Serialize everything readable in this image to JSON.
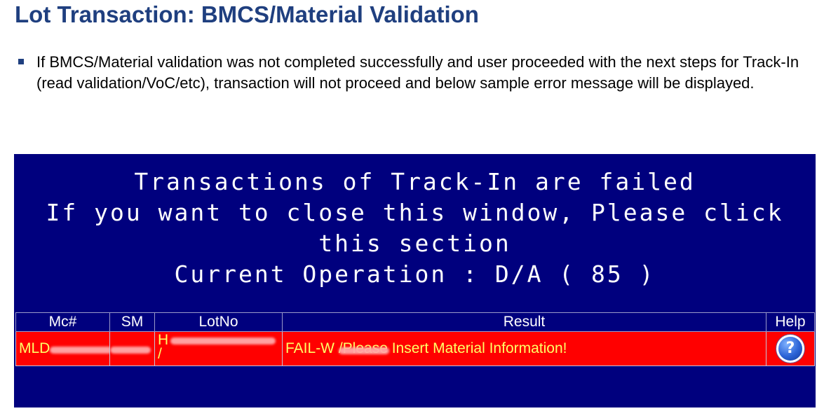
{
  "slide": {
    "title": "Lot Transaction: BMCS/Material Validation",
    "bullet": "If BMCS/Material validation was not completed successfully and user proceeded with the next steps for Track-In (read validation/VoC/etc), transaction will not proceed and below sample error message will be displayed."
  },
  "error_window": {
    "message_lines": [
      "Transactions of Track-In are failed",
      "If you want to close this window, Please click this section",
      "Current Operation : D/A ( 85 )"
    ],
    "columns": [
      "Mc#",
      "SM",
      "LotNo",
      "Result",
      "Help"
    ],
    "row": {
      "mc": "MLD",
      "sm": "",
      "lotno": "H /",
      "result": "FAIL-W /Please Insert Material Information!",
      "help_icon": "question-mark-icon"
    },
    "colors": {
      "panel": "#00007e",
      "row_bg": "#ff0000",
      "row_text": "#ffff66"
    }
  }
}
